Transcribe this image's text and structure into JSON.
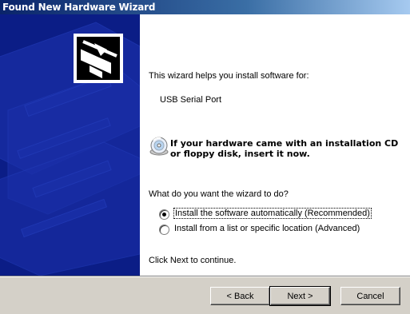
{
  "window": {
    "title": "Found New Hardware Wizard"
  },
  "intro": {
    "text": "This wizard helps you install software for:",
    "device": "USB Serial Port"
  },
  "cd_prompt": {
    "text": "If your hardware came with an installation CD or floppy disk, insert it now."
  },
  "question": "What do you want the wizard to do?",
  "options": [
    {
      "label": "Install the software automatically (Recommended)",
      "selected": true
    },
    {
      "label": "Install from a list or specific location (Advanced)",
      "selected": false
    }
  ],
  "continue_text": "Click Next to continue.",
  "buttons": {
    "back": "< Back",
    "next": "Next >",
    "cancel": "Cancel"
  },
  "colors": {
    "banner": "#0b1d86",
    "titlebar": "#0a246a"
  }
}
